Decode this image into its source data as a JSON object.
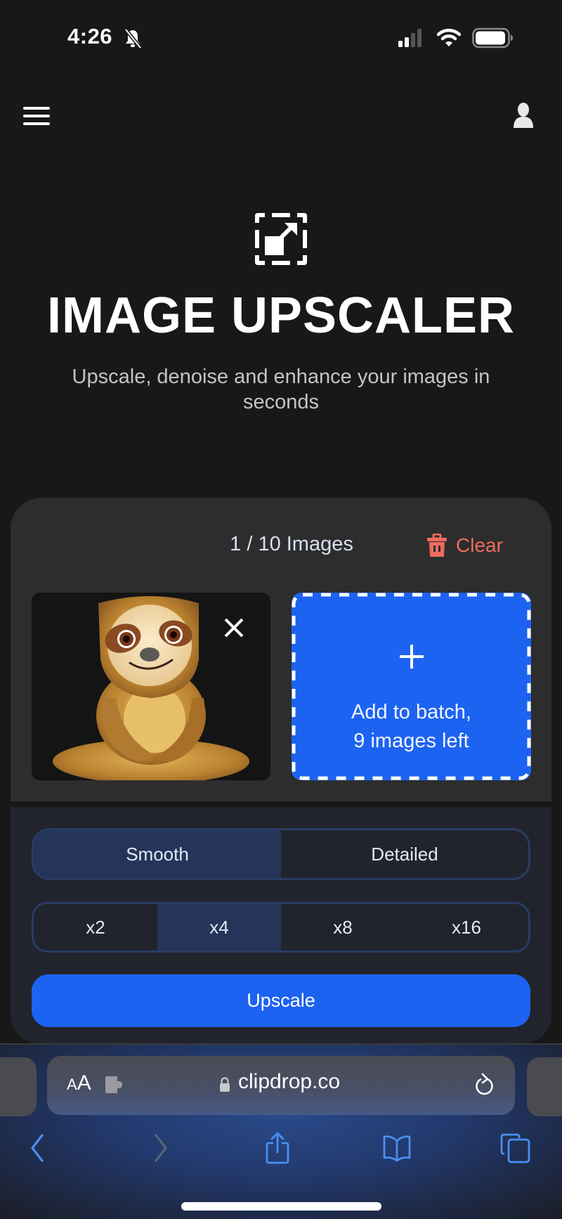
{
  "status_bar": {
    "time": "4:26",
    "silent_mode": true,
    "signal_bars_active": 2,
    "signal_bars_total": 4,
    "wifi": "connected",
    "battery_level": 0.9
  },
  "nav": {
    "menu_icon": "hamburger-menu-icon",
    "account_icon": "user-icon"
  },
  "hero": {
    "icon": "upscale-expand-icon",
    "title": "IMAGE UPSCALER",
    "subtitle": "Upscale, denoise and enhance your images in seconds"
  },
  "upload": {
    "image_count": "1 / 10 Images",
    "clear_label": "Clear",
    "clear_color": "#ee6b5e",
    "images": [
      {
        "alt": "Cartoon sloth sitting cross-legged",
        "remove_icon": "close-icon"
      }
    ],
    "add_batch": {
      "icon": "plus-icon",
      "line1": "Add to batch,",
      "line2": "9 images left"
    }
  },
  "settings": {
    "modes": [
      {
        "label": "Smooth",
        "active": true
      },
      {
        "label": "Detailed",
        "active": false
      }
    ],
    "scales": [
      {
        "label": "x2",
        "active": false
      },
      {
        "label": "x4",
        "active": true
      },
      {
        "label": "x8",
        "active": false
      },
      {
        "label": "x16",
        "active": false
      }
    ],
    "upscale_label": "Upscale",
    "accent_color": "#1d63f2"
  },
  "browser": {
    "text_size_small": "A",
    "text_size_large": "A",
    "url": "clipdrop.co",
    "secure": true,
    "toolbar": [
      "back",
      "forward",
      "share",
      "bookmarks",
      "tabs"
    ],
    "forward_enabled": false
  }
}
